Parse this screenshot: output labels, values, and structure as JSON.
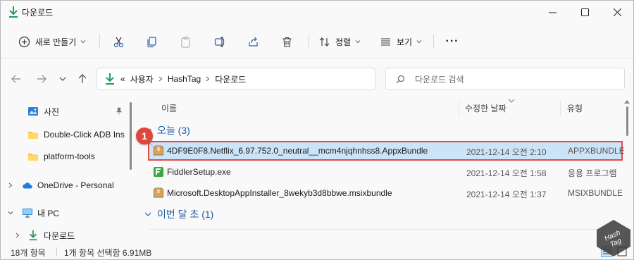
{
  "window": {
    "title": "다운로드"
  },
  "command_bar": {
    "new_label": "새로 만들기",
    "sort_label": "정렬",
    "view_label": "보기",
    "more_label": "···"
  },
  "address": {
    "overflow": "«",
    "crumbs": [
      "사용자",
      "HashTag",
      "다운로드"
    ]
  },
  "search": {
    "placeholder": "다운로드 검색"
  },
  "nav": {
    "items": [
      {
        "label": "사진"
      },
      {
        "label": "Double-Click ADB Ins"
      },
      {
        "label": "platform-tools"
      },
      {
        "label": "OneDrive - Personal"
      },
      {
        "label": "내 PC"
      },
      {
        "label": "다운로드"
      }
    ]
  },
  "columns": {
    "name": "이름",
    "modified": "수정한 날짜",
    "type": "유형"
  },
  "groups": [
    {
      "label": "오늘 (3)"
    },
    {
      "label": "이번 달 초 (1)"
    }
  ],
  "files": [
    {
      "name": "4DF9E0F8.Netflix_6.97.752.0_neutral__mcm4njqhnhss8.AppxBundle",
      "date": "2021-12-14 오전 2:10",
      "type": "APPXBUNDLE"
    },
    {
      "name": "FiddlerSetup.exe",
      "date": "2021-12-14 오전 1:58",
      "type": "응용 프로그램"
    },
    {
      "name": "Microsoft.DesktopAppInstaller_8wekyb3d8bbwe.msixbundle",
      "date": "2021-12-14 오전 1:37",
      "type": "MSIXBUNDLE"
    }
  ],
  "status": {
    "count": "18개 항목",
    "selection": "1개 항목 선택함 6.91MB"
  },
  "callout": {
    "number": "1"
  },
  "colors": {
    "accent_green": "#1f9d55",
    "selection_bg": "#cce4f7",
    "highlight_red": "#e2494a",
    "group_blue": "#1f5ea8"
  }
}
